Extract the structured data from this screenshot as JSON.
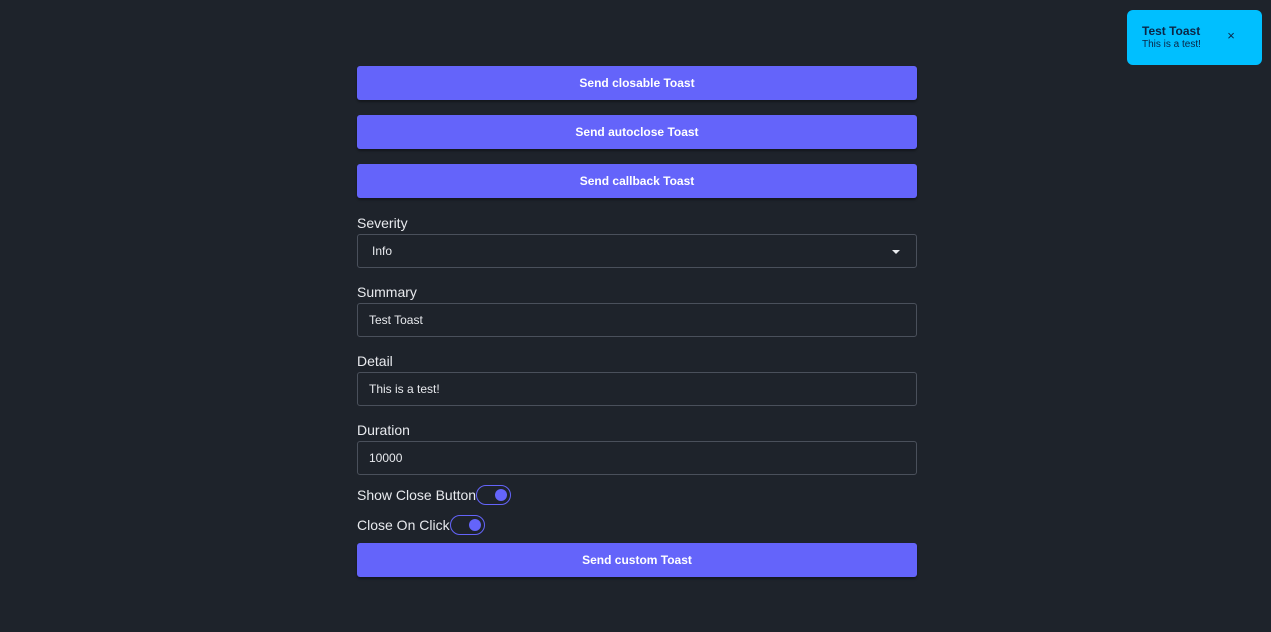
{
  "buttons": {
    "closable": "Send closable Toast",
    "autoclose": "Send autoclose Toast",
    "callback": "Send callback Toast",
    "custom": "Send custom Toast"
  },
  "form": {
    "severity": {
      "label": "Severity",
      "value": "Info"
    },
    "summary": {
      "label": "Summary",
      "value": "Test Toast"
    },
    "detail": {
      "label": "Detail",
      "value": "This is a test!"
    },
    "duration": {
      "label": "Duration",
      "value": "10000"
    },
    "show_close_button": {
      "label": "Show Close Button",
      "checked": true
    },
    "close_on_click": {
      "label": "Close On Click",
      "checked": true
    }
  },
  "toast": {
    "title": "Test Toast",
    "detail": "This is a test!",
    "close_glyph": "×"
  },
  "colors": {
    "background": "#1e232b",
    "accent": "#6464fa",
    "toast_info": "#00bfff"
  }
}
